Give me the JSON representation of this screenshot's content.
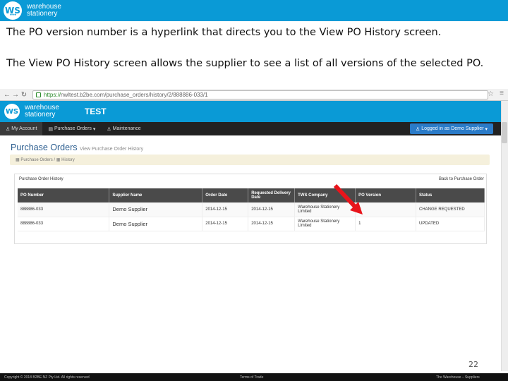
{
  "brand": {
    "name_line1": "warehouse",
    "name_line2": "stationery",
    "logo": "WS"
  },
  "text": {
    "para1": "The PO version number is a hyperlink that directs you to the View PO History screen.",
    "para2": "The View PO History screen allows the supplier to see a list of all versions of the selected PO."
  },
  "browser": {
    "url_scheme": "https://",
    "url_host": "nwltest.b2be.com",
    "url_path": "/purchase_orders/history/2/888886-033/1"
  },
  "app": {
    "title": "TEST",
    "nav": [
      "My Account",
      "Purchase Orders",
      "Maintenance"
    ],
    "login_button": "Logged in as Demo Supplier"
  },
  "page": {
    "heading": "Purchase Orders",
    "subheading": "View Purchase Order History",
    "breadcrumb": [
      "Purchase Orders",
      "History"
    ],
    "panel_title": "Purchase Order History",
    "back_link": "Back to Purchase Order"
  },
  "table": {
    "columns": [
      "PO Number",
      "Supplier Name",
      "Order Date",
      "Requested Delivery Date",
      "TWS Company",
      "PO Version",
      "Status"
    ],
    "rows": [
      [
        "888886-033",
        "Demo Supplier",
        "2014-12-15",
        "2014-12-15",
        "Warehouse Stationery Limited",
        "0",
        "CHANGE REQUESTED"
      ],
      [
        "888886-033",
        "Demo Supplier",
        "2014-12-15",
        "2014-12-15",
        "Warehouse Stationery Limited",
        "1",
        "UPDATED"
      ]
    ]
  },
  "slide": {
    "page_number": "22"
  },
  "footer": {
    "copyright": "Copyright © 2018 B2BE NZ Pty Ltd. All rights reserved",
    "terms": "Terms of Trade",
    "support": "The Warehouse – Suppliers"
  },
  "colors": {
    "brand_blue": "#0a9ad6",
    "arrow_red": "#e8141b"
  }
}
